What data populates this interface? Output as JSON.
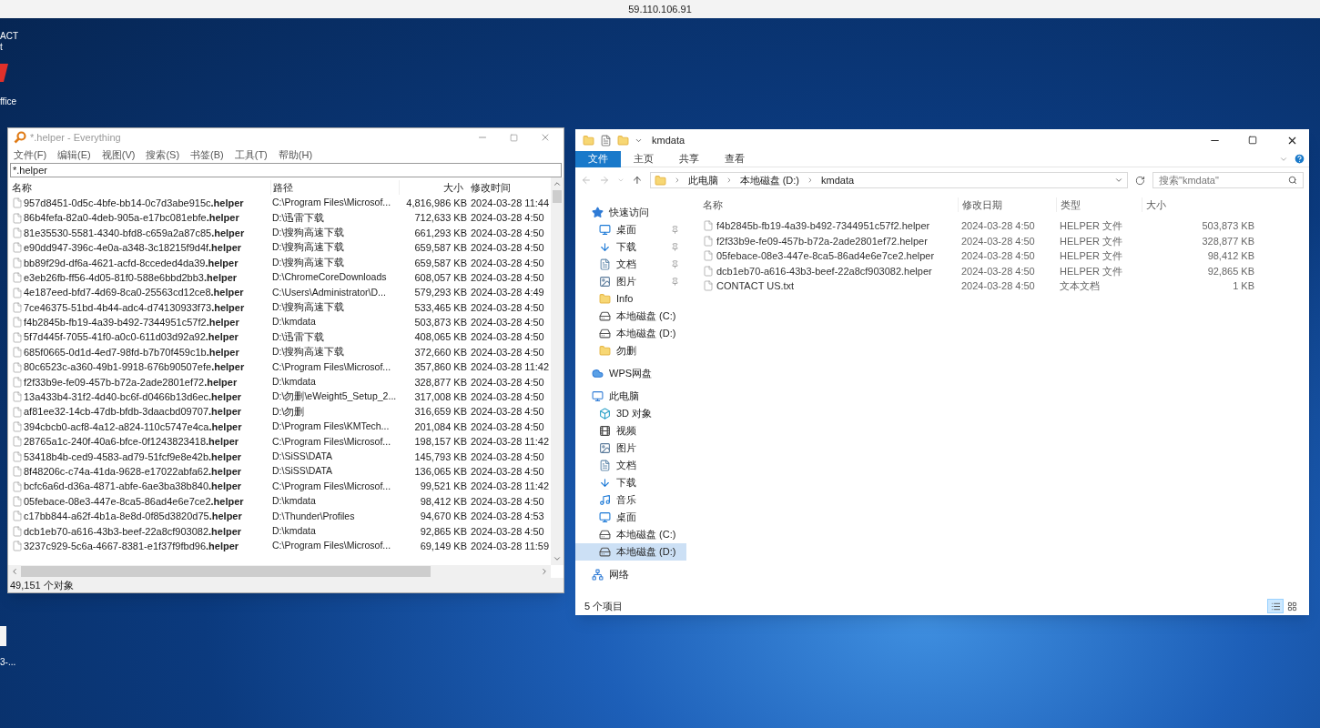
{
  "remote_bar": {
    "title": "59.110.106.91"
  },
  "desktop_icons": [
    {
      "label": "ACT\nt",
      "kind": "text"
    },
    {
      "label": "ffice",
      "kind": "office"
    },
    {
      "label": "3-...",
      "kind": "file"
    }
  ],
  "everything": {
    "title": "*.helper - Everything",
    "menu": [
      "文件(F)",
      "编辑(E)",
      "视图(V)",
      "搜索(S)",
      "书签(B)",
      "工具(T)",
      "帮助(H)"
    ],
    "search": {
      "value": "*.helper"
    },
    "columns": [
      "名称",
      "路径",
      "大小",
      "修改时间"
    ],
    "rows": [
      {
        "name": "957d8451-0d5c-4bfe-bb14-0c7d3abe915c**.helper**",
        "path": "C:\\Program Files\\Microsof...",
        "size": "4,816,986 KB",
        "modified": "2024-03-28 11:44"
      },
      {
        "name": "86b4fefa-82a0-4deb-905a-e17bc081ebfe**.helper**",
        "path": "D:\\迅雷下载",
        "size": "712,633 KB",
        "modified": "2024-03-28 4:50"
      },
      {
        "name": "81e35530-5581-4340-bfd8-c659a2a87c85**.helper**",
        "path": "D:\\搜狗高速下载",
        "size": "661,293 KB",
        "modified": "2024-03-28 4:50"
      },
      {
        "name": "e90dd947-396c-4e0a-a348-3c18215f9d4f**.helper**",
        "path": "D:\\搜狗高速下载",
        "size": "659,587 KB",
        "modified": "2024-03-28 4:50"
      },
      {
        "name": "bb89f29d-df6a-4621-acfd-8cceded4da39**.helper**",
        "path": "D:\\搜狗高速下载",
        "size": "659,587 KB",
        "modified": "2024-03-28 4:50"
      },
      {
        "name": "e3eb26fb-ff56-4d05-81f0-588e6bbd2bb3**.helper**",
        "path": "D:\\ChromeCoreDownloads",
        "size": "608,057 KB",
        "modified": "2024-03-28 4:50"
      },
      {
        "name": "4e187eed-bfd7-4d69-8ca0-25563cd12ce8**.helper**",
        "path": "C:\\Users\\Administrator\\D...",
        "size": "579,293 KB",
        "modified": "2024-03-28 4:49"
      },
      {
        "name": "7ce46375-51bd-4b44-adc4-d74130933f73**.helper**",
        "path": "D:\\搜狗高速下载",
        "size": "533,465 KB",
        "modified": "2024-03-28 4:50"
      },
      {
        "name": "f4b2845b-fb19-4a39-b492-7344951c57f2**.helper**",
        "path": "D:\\kmdata",
        "size": "503,873 KB",
        "modified": "2024-03-28 4:50"
      },
      {
        "name": "5f7d445f-7055-41f0-a0c0-611d03d92a92**.helper**",
        "path": "D:\\迅雷下载",
        "size": "408,065 KB",
        "modified": "2024-03-28 4:50"
      },
      {
        "name": "685f0665-0d1d-4ed7-98fd-b7b70f459c1b**.helper**",
        "path": "D:\\搜狗高速下载",
        "size": "372,660 KB",
        "modified": "2024-03-28 4:50"
      },
      {
        "name": "80c6523c-a360-49b1-9918-676b90507efe**.helper**",
        "path": "C:\\Program Files\\Microsof...",
        "size": "357,860 KB",
        "modified": "2024-03-28 11:42"
      },
      {
        "name": "f2f33b9e-fe09-457b-b72a-2ade2801ef72**.helper**",
        "path": "D:\\kmdata",
        "size": "328,877 KB",
        "modified": "2024-03-28 4:50"
      },
      {
        "name": "13a433b4-31f2-4d40-bc6f-d0466b13d6ec**.helper**",
        "path": "D:\\勿删\\eWeight5_Setup_2...",
        "size": "317,008 KB",
        "modified": "2024-03-28 4:50"
      },
      {
        "name": "af81ee32-14cb-47db-bfdb-3daacbd09707**.helper**",
        "path": "D:\\勿删",
        "size": "316,659 KB",
        "modified": "2024-03-28 4:50"
      },
      {
        "name": "394cbcb0-acf8-4a12-a824-110c5747e4ca**.helper**",
        "path": "D:\\Program Files\\KMTech...",
        "size": "201,084 KB",
        "modified": "2024-03-28 4:50"
      },
      {
        "name": "28765a1c-240f-40a6-bfce-0f1243823418**.helper**",
        "path": "C:\\Program Files\\Microsof...",
        "size": "198,157 KB",
        "modified": "2024-03-28 11:42"
      },
      {
        "name": "53418b4b-ced9-4583-ad79-51fcf9e8e42b**.helper**",
        "path": "D:\\SiSS\\DATA",
        "size": "145,793 KB",
        "modified": "2024-03-28 4:50"
      },
      {
        "name": "8f48206c-c74a-41da-9628-e17022abfa62**.helper**",
        "path": "D:\\SiSS\\DATA",
        "size": "136,065 KB",
        "modified": "2024-03-28 4:50"
      },
      {
        "name": "bcfc6a6d-d36a-4871-abfe-6ae3ba38b840**.helper**",
        "path": "C:\\Program Files\\Microsof...",
        "size": "99,521 KB",
        "modified": "2024-03-28 11:42"
      },
      {
        "name": "05febace-08e3-447e-8ca5-86ad4e6e7ce2**.helper**",
        "path": "D:\\kmdata",
        "size": "98,412 KB",
        "modified": "2024-03-28 4:50"
      },
      {
        "name": "c17bb844-a62f-4b1a-8e8d-0f85d3820d75**.helper**",
        "path": "D:\\Thunder\\Profiles",
        "size": "94,670 KB",
        "modified": "2024-03-28 4:53"
      },
      {
        "name": "dcb1eb70-a616-43b3-beef-22a8cf903082**.helper**",
        "path": "D:\\kmdata",
        "size": "92,865 KB",
        "modified": "2024-03-28 4:50"
      },
      {
        "name": "3237c929-5c6a-4667-8381-e1f37f9fbd96**.helper**",
        "path": "C:\\Program Files\\Microsof...",
        "size": "69,149 KB",
        "modified": "2024-03-28 11:59"
      }
    ],
    "status": "49,151 个对象"
  },
  "explorer": {
    "title": "kmdata",
    "ribbon_tabs": [
      {
        "label": "文件",
        "selected": true
      },
      {
        "label": "主页",
        "selected": false
      },
      {
        "label": "共享",
        "selected": false
      },
      {
        "label": "查看",
        "selected": false
      }
    ],
    "breadcrumb": [
      "此电脑",
      "本地磁盘 (D:)",
      "kmdata"
    ],
    "search": {
      "placeholder": "搜索\"kmdata\""
    },
    "nav": [
      {
        "label": "快速访问",
        "kind": "star",
        "selected": false,
        "children": [
          {
            "label": "桌面",
            "kind": "desktop",
            "pinned": true,
            "selected": false
          },
          {
            "label": "下载",
            "kind": "download",
            "pinned": true,
            "selected": false
          },
          {
            "label": "文档",
            "kind": "document",
            "pinned": true,
            "selected": false
          },
          {
            "label": "图片",
            "kind": "picture",
            "pinned": true,
            "selected": false
          },
          {
            "label": "Info",
            "kind": "folder",
            "pinned": false,
            "selected": false
          },
          {
            "label": "本地磁盘 (C:)",
            "kind": "drive",
            "pinned": false,
            "selected": false
          },
          {
            "label": "本地磁盘 (D:)",
            "kind": "drive",
            "pinned": false,
            "selected": false
          },
          {
            "label": "勿删",
            "kind": "folder",
            "pinned": false,
            "selected": false
          }
        ]
      },
      {
        "label": "WPS网盘",
        "kind": "cloud",
        "selected": false
      },
      {
        "label": "此电脑",
        "kind": "pc",
        "selected": false,
        "children": [
          {
            "label": "3D 对象",
            "kind": "cube",
            "pinned": false,
            "selected": false
          },
          {
            "label": "视频",
            "kind": "video",
            "pinned": false,
            "selected": false
          },
          {
            "label": "图片",
            "kind": "picture",
            "pinned": false,
            "selected": false
          },
          {
            "label": "文档",
            "kind": "document",
            "pinned": false,
            "selected": false
          },
          {
            "label": "下载",
            "kind": "download",
            "pinned": false,
            "selected": false
          },
          {
            "label": "音乐",
            "kind": "music",
            "pinned": false,
            "selected": false
          },
          {
            "label": "桌面",
            "kind": "desktop",
            "pinned": false,
            "selected": false
          },
          {
            "label": "本地磁盘 (C:)",
            "kind": "drive",
            "pinned": false,
            "selected": false
          },
          {
            "label": "本地磁盘 (D:)",
            "kind": "drive",
            "pinned": false,
            "selected": true
          }
        ]
      },
      {
        "label": "网络",
        "kind": "network",
        "selected": false
      }
    ],
    "columns": [
      "名称",
      "修改日期",
      "类型",
      "大小"
    ],
    "files": [
      {
        "name": "f4b2845b-fb19-4a39-b492-7344951c57f2.helper",
        "modified": "2024-03-28 4:50",
        "type": "HELPER 文件",
        "size": "503,873 KB"
      },
      {
        "name": "f2f33b9e-fe09-457b-b72a-2ade2801ef72.helper",
        "modified": "2024-03-28 4:50",
        "type": "HELPER 文件",
        "size": "328,877 KB"
      },
      {
        "name": "05febace-08e3-447e-8ca5-86ad4e6e7ce2.helper",
        "modified": "2024-03-28 4:50",
        "type": "HELPER 文件",
        "size": "98,412 KB"
      },
      {
        "name": "dcb1eb70-a616-43b3-beef-22a8cf903082.helper",
        "modified": "2024-03-28 4:50",
        "type": "HELPER 文件",
        "size": "92,865 KB"
      },
      {
        "name": "CONTACT US.txt",
        "modified": "2024-03-28 4:50",
        "type": "文本文档",
        "size": "1 KB"
      }
    ],
    "status": "5 个项目",
    "view_buttons": [
      {
        "kind": "details",
        "selected": true
      },
      {
        "kind": "tiles",
        "selected": false
      }
    ]
  }
}
